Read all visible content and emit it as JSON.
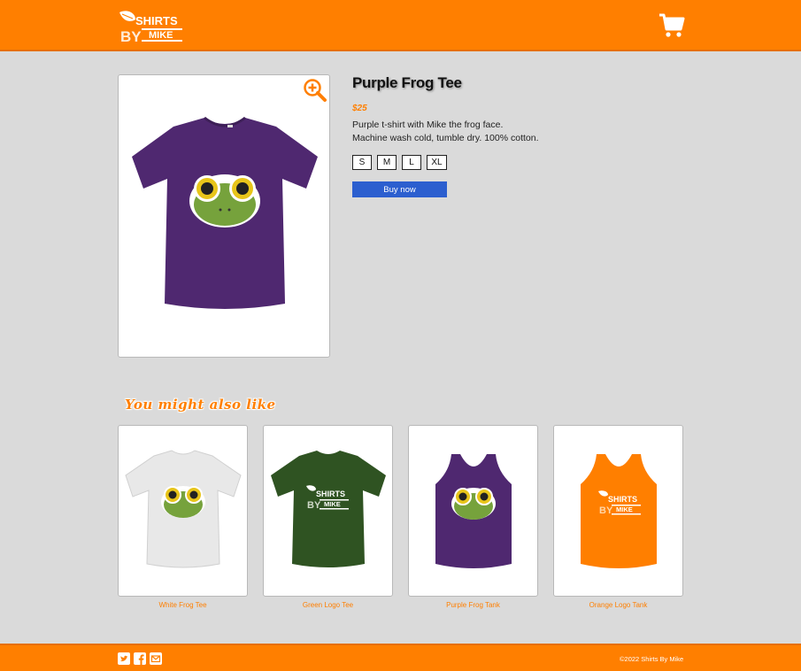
{
  "brand": {
    "logo_alt": "Shirts By Mike",
    "logo_text_top": "SHIRTS",
    "logo_text_by": "BY",
    "logo_text_mike": "MIKE",
    "accent": "#ff7f00",
    "button_color": "#2c5fcf"
  },
  "header": {
    "cart_icon": "shopping-cart-icon"
  },
  "product": {
    "title": "Purple Frog Tee",
    "price": "$25",
    "description_line1": "Purple t-shirt with Mike the frog face.",
    "description_line2": "Machine wash cold, tumble dry. 100% cotton.",
    "sizes": [
      "S",
      "M",
      "L",
      "XL"
    ],
    "buy_label": "Buy now",
    "zoom_icon": "zoom-in-icon",
    "shirt_color": "#4f2870"
  },
  "related": {
    "heading": "You might also like",
    "items": [
      {
        "label": "White Frog Tee",
        "color": "#e8e8e8"
      },
      {
        "label": "Green Logo Tee",
        "color": "#2f5322"
      },
      {
        "label": "Purple Frog Tank",
        "color": "#4f2870"
      },
      {
        "label": "Orange Logo Tank",
        "color": "#ff7f00"
      }
    ]
  },
  "footer": {
    "icons": [
      "twitter-icon",
      "facebook-icon",
      "email-icon"
    ],
    "copyright": "©2022 Shirts By Mike"
  }
}
